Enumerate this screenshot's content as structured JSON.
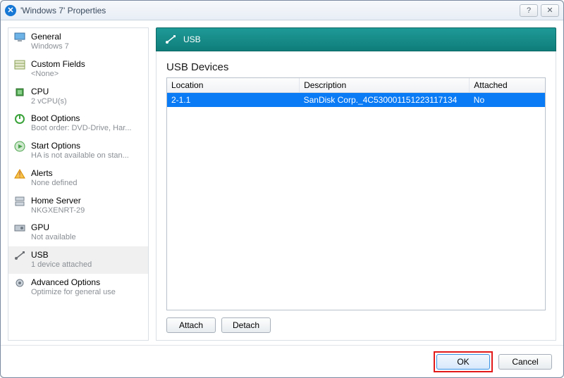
{
  "window": {
    "title": "'Windows 7' Properties"
  },
  "titlebar_icons": {
    "help": "?",
    "close": "✕"
  },
  "sidebar": {
    "items": [
      {
        "label": "General",
        "sub": "Windows 7"
      },
      {
        "label": "Custom Fields",
        "sub": "<None>"
      },
      {
        "label": "CPU",
        "sub": "2 vCPU(s)"
      },
      {
        "label": "Boot Options",
        "sub": "Boot order: DVD-Drive, Har..."
      },
      {
        "label": "Start Options",
        "sub": "HA is not available on stan..."
      },
      {
        "label": "Alerts",
        "sub": "None defined"
      },
      {
        "label": "Home Server",
        "sub": "NKGXENRT-29"
      },
      {
        "label": "GPU",
        "sub": "Not available"
      },
      {
        "label": "USB",
        "sub": "1 device attached"
      },
      {
        "label": "Advanced Options",
        "sub": "Optimize for general use"
      }
    ]
  },
  "main": {
    "banner": "USB",
    "section_title": "USB Devices",
    "columns": {
      "location": "Location",
      "description": "Description",
      "attached": "Attached"
    },
    "rows": [
      {
        "location": "2-1.1",
        "description": "SanDisk Corp._4C530001151223117134",
        "attached": "No"
      }
    ],
    "buttons": {
      "attach": "Attach",
      "detach": "Detach"
    }
  },
  "footer": {
    "ok": "OK",
    "cancel": "Cancel"
  }
}
